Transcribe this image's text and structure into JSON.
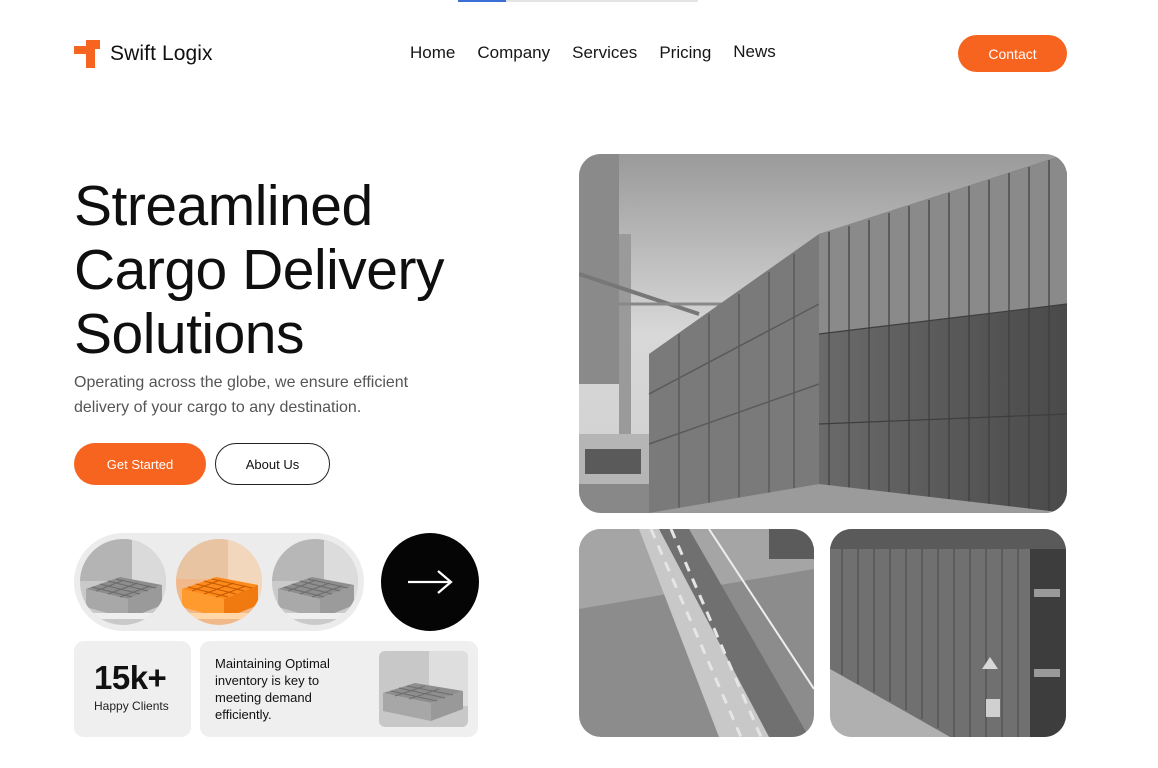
{
  "brand": {
    "name": "Swift Logix",
    "accent": "#f76420",
    "logo_icon": "logo-icon"
  },
  "nav": {
    "items": [
      "Home",
      "Company",
      "Services",
      "Pricing",
      "News"
    ]
  },
  "header": {
    "contact_label": "Contact"
  },
  "hero": {
    "title_lines": [
      "Streamlined",
      "Cargo Delivery",
      "Solutions"
    ],
    "subtitle": "Operating across the globe, we ensure efficient delivery of your cargo to any destination.",
    "primary_label": "Get Started",
    "secondary_label": "About Us"
  },
  "products": {
    "thumbnails": [
      "pallet-grey",
      "pallet-orange",
      "pallet-grey"
    ],
    "next_icon": "arrow-right-icon"
  },
  "stats": {
    "value": "15k+",
    "label": "Happy Clients"
  },
  "info": {
    "text": "Maintaining Optimal inventory is key to meeting demand efficiently."
  },
  "photos": [
    "container-yard",
    "warehouse-floor",
    "container-side"
  ]
}
